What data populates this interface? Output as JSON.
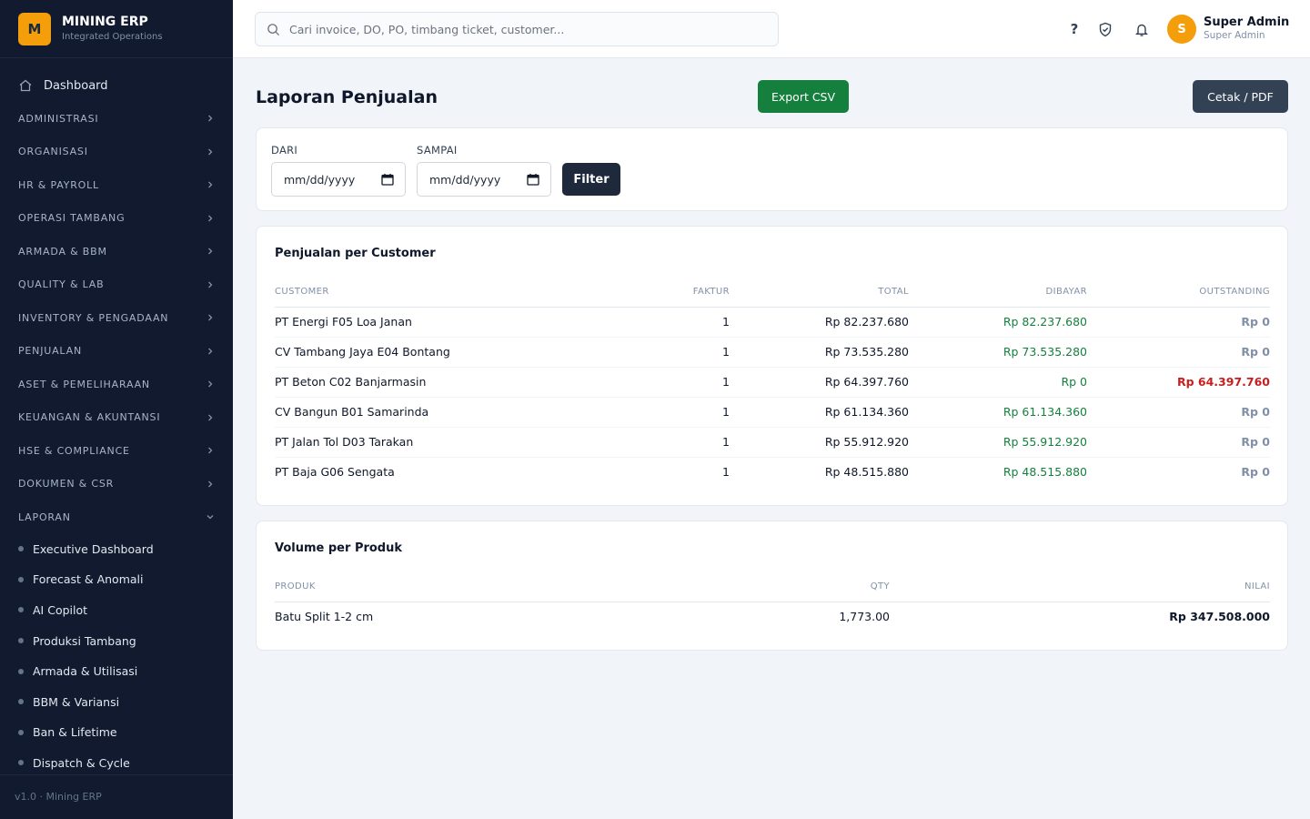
{
  "brand": {
    "logo": "M",
    "title": "MINING ERP",
    "subtitle": "Integrated Operations"
  },
  "sidebar": {
    "dashboard": "Dashboard",
    "groups": [
      "ADMINISTRASI",
      "ORGANISASI",
      "HR & PAYROLL",
      "OPERASI TAMBANG",
      "ARMADA & BBM",
      "QUALITY & LAB",
      "INVENTORY & PENGADAAN",
      "PENJUALAN",
      "ASET & PEMELIHARAAN",
      "KEUANGAN & AKUNTANSI",
      "HSE & COMPLIANCE",
      "DOKUMEN & CSR"
    ],
    "open_group": "LAPORAN",
    "sub_items": [
      "Executive Dashboard",
      "Forecast & Anomali",
      "AI Copilot",
      "Produksi Tambang",
      "Armada & Utilisasi",
      "BBM & Variansi",
      "Ban & Lifetime",
      "Dispatch & Cycle"
    ],
    "footer": "v1.0 · Mining ERP"
  },
  "header": {
    "search_placeholder": "Cari invoice, DO, PO, timbang ticket, customer...",
    "help_label": "?",
    "user": {
      "initial": "S",
      "name": "Super Admin",
      "role": "Super Admin"
    }
  },
  "page": {
    "title": "Laporan Penjualan",
    "export_label": "Export CSV",
    "print_label": "Cetak / PDF"
  },
  "filter": {
    "from_label": "DARI",
    "to_label": "SAMPAI",
    "from_value": "mm/dd/yyyy",
    "to_value": "mm/dd/yyyy",
    "button": "Filter"
  },
  "customer_table": {
    "title": "Penjualan per Customer",
    "headers": [
      "CUSTOMER",
      "FAKTUR",
      "TOTAL",
      "DIBAYAR",
      "OUTSTANDING"
    ],
    "rows": [
      [
        "PT Energi F05 Loa Janan",
        "1",
        "Rp 82.237.680",
        "Rp 82.237.680",
        "Rp 0"
      ],
      [
        "CV Tambang Jaya E04 Bontang",
        "1",
        "Rp 73.535.280",
        "Rp 73.535.280",
        "Rp 0"
      ],
      [
        "PT Beton C02 Banjarmasin",
        "1",
        "Rp 64.397.760",
        "Rp 0",
        "Rp 64.397.760"
      ],
      [
        "CV Bangun B01 Samarinda",
        "1",
        "Rp 61.134.360",
        "Rp 61.134.360",
        "Rp 0"
      ],
      [
        "PT Jalan Tol D03 Tarakan",
        "1",
        "Rp 55.912.920",
        "Rp 55.912.920",
        "Rp 0"
      ],
      [
        "PT Baja G06 Sengata",
        "1",
        "Rp 48.515.880",
        "Rp 48.515.880",
        "Rp 0"
      ]
    ]
  },
  "product_table": {
    "title": "Volume per Produk",
    "headers": [
      "PRODUK",
      "QTY",
      "NILAI"
    ],
    "rows": [
      [
        "Batu Split 1-2 cm",
        "1,773.00",
        "Rp 347.508.000"
      ]
    ]
  },
  "colors": {
    "sidebar_bg": "#111a2e",
    "accent": "#f59e0b",
    "export_green": "#15803d",
    "outstanding_red": "#c81e1e",
    "paid_green": "#15803d"
  }
}
